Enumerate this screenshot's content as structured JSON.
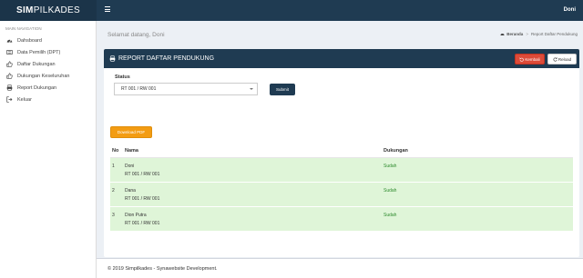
{
  "app": {
    "logo_bold": "SIM",
    "logo_rest": "PILKADES",
    "user": "Doni"
  },
  "sidebar": {
    "header": "MAIN NAVIGATION",
    "items": [
      {
        "label": "Dahsboard",
        "icon": "dashboard-icon"
      },
      {
        "label": "Data Pemilih (DPT)",
        "icon": "file-icon"
      },
      {
        "label": "Daftar Dukungan",
        "icon": "thumbs-up-icon"
      },
      {
        "label": "Dukungan Keseluruhan",
        "icon": "thumbs-up-icon"
      },
      {
        "label": "Report Dukungan",
        "icon": "print-icon"
      },
      {
        "label": "Keluar",
        "icon": "sign-out-icon"
      }
    ]
  },
  "header": {
    "welcome": "Selamat datang, Doni",
    "breadcrumb": {
      "home": "Beranda",
      "current": "Report Daftar Pendukung"
    }
  },
  "box": {
    "title": "REPORT DAFTAR PENDUKUNG",
    "kembali_label": "Kembali",
    "reload_label": "Reload",
    "status_label": "Status",
    "status_selected": "RT 001 / RW 001",
    "submit_label": "Submit",
    "pdf_label": "Download PDF"
  },
  "table": {
    "columns": [
      "No",
      "Nama",
      "Dukungan"
    ],
    "rows": [
      {
        "no": "1",
        "nama": "Doni",
        "rt": "RT 001 / RW 001",
        "dukungan": "Sudah"
      },
      {
        "no": "2",
        "nama": "Dana",
        "rt": "RT 001 / RW 001",
        "dukungan": "Sudah"
      },
      {
        "no": "3",
        "nama": "Dion Putra",
        "rt": "RT 001 / RW 001",
        "dukungan": "Sudah"
      }
    ]
  },
  "footer": {
    "text": "© 2019 Simpilkades - Synawebsite Development."
  },
  "colors": {
    "navbar": "#1f3b52",
    "danger": "#dd4b39",
    "warning": "#f39c12",
    "success_row": "#dff5d8",
    "success_text": "#2e8b2e"
  }
}
